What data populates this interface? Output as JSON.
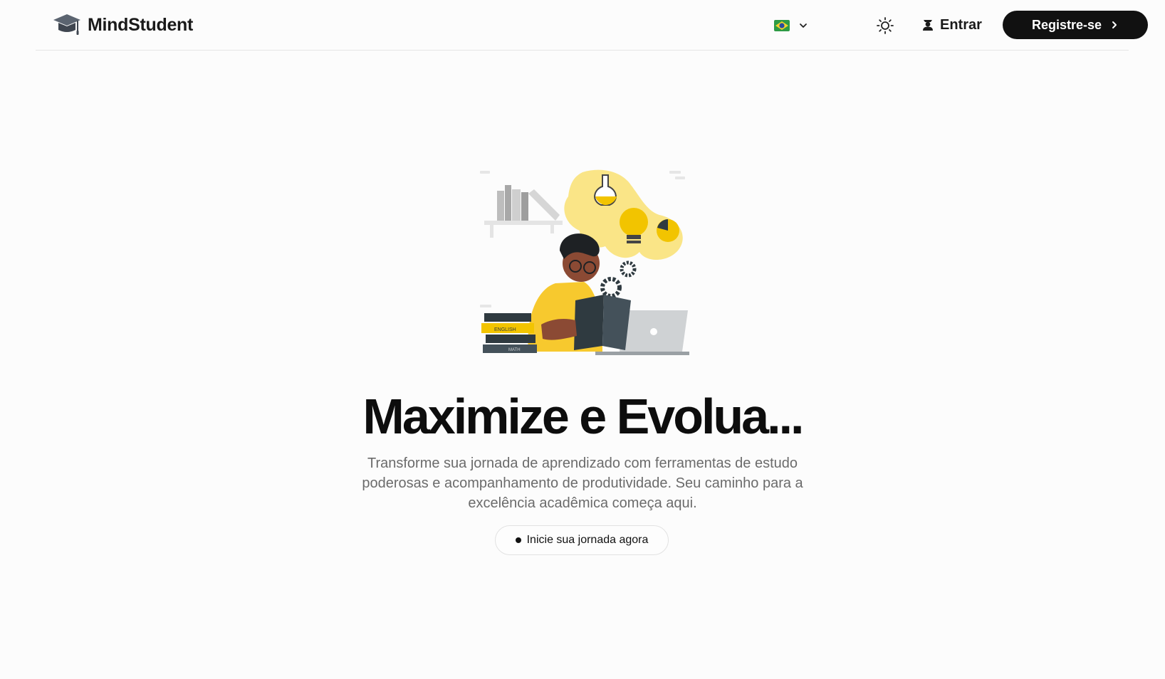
{
  "header": {
    "brand_name": "MindStudent",
    "brand_icon": "graduation-cap-icon",
    "language": {
      "flag": "brazil-flag-icon",
      "selected": "pt-BR"
    },
    "theme_toggle_icon": "sun-icon",
    "login_label": "Entrar",
    "login_icon": "user-icon",
    "register_label": "Registre-se",
    "register_icon": "chevron-right-icon"
  },
  "hero": {
    "illustration": "student-reading-illustration",
    "book_labels": [
      "ENGLISH",
      "MATH"
    ],
    "title": "Maximize e Evolua...",
    "subtitle": "Transforme sua jornada de aprendizado com ferramentas de estudo poderosas e acompanhamento de produtividade. Seu caminho para a excelência acadêmica começa aqui.",
    "cta_label": "Inicie sua jornada agora"
  },
  "colors": {
    "background": "#fcfcfc",
    "primary": "#111111",
    "accent_yellow": "#f9d73a",
    "text_muted": "#6b6b6b"
  }
}
